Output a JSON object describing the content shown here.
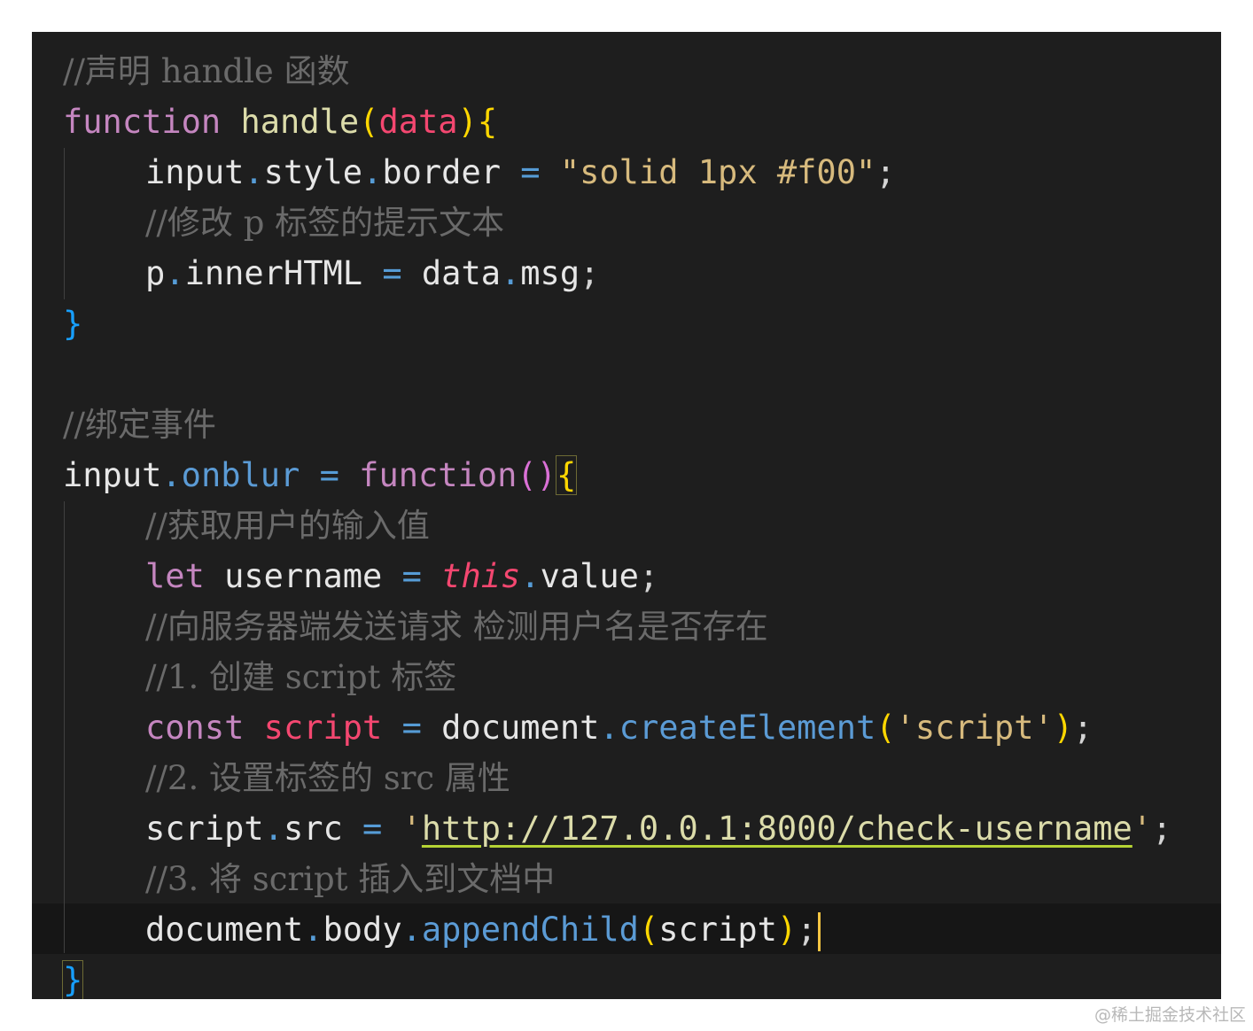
{
  "editor": {
    "lines": {
      "l1_comment": "//声明 handle 函数",
      "l2_kw": "function",
      "l2_name": "handle",
      "l2_param": "data",
      "l3_obj": "input",
      "l3_prop1": "style",
      "l3_prop2": "border",
      "l3_str": "\"solid 1px #f00\"",
      "l4_comment": "//修改 p 标签的提示文本",
      "l5_obj": "p",
      "l5_prop": "innerHTML",
      "l5_val_obj": "data",
      "l5_val_prop": "msg",
      "l6_close": "}",
      "l8_comment": "//绑定事件",
      "l9_obj": "input",
      "l9_prop": "onblur",
      "l9_kw": "function",
      "l10_comment": "//获取用户的输入值",
      "l11_kw": "let",
      "l11_var": "username",
      "l11_this": "this",
      "l11_prop": "value",
      "l12_comment": "//向服务器端发送请求 检测用户名是否存在",
      "l13_comment": "//1. 创建 script 标签",
      "l14_kw": "const",
      "l14_var": "script",
      "l14_obj": "document",
      "l14_fn": "createElement",
      "l14_str": "'script'",
      "l15_comment": "//2. 设置标签的 src 属性",
      "l16_obj": "script",
      "l16_prop": "src",
      "l16_url": "http://127.0.0.1:8000/check-username",
      "l17_comment": "//3. 将 script 插入到文档中",
      "l18_obj": "document",
      "l18_prop": "body",
      "l18_fn": "appendChild",
      "l18_arg": "script",
      "l19_close": "}"
    },
    "colors": {
      "background": "#1e1e1e",
      "keyword": "#c586c0",
      "function": "#dcdcaa",
      "comment": "#6a6a6a",
      "parameter": "#f44770"
    }
  },
  "watermark": "@稀土掘金技术社区"
}
